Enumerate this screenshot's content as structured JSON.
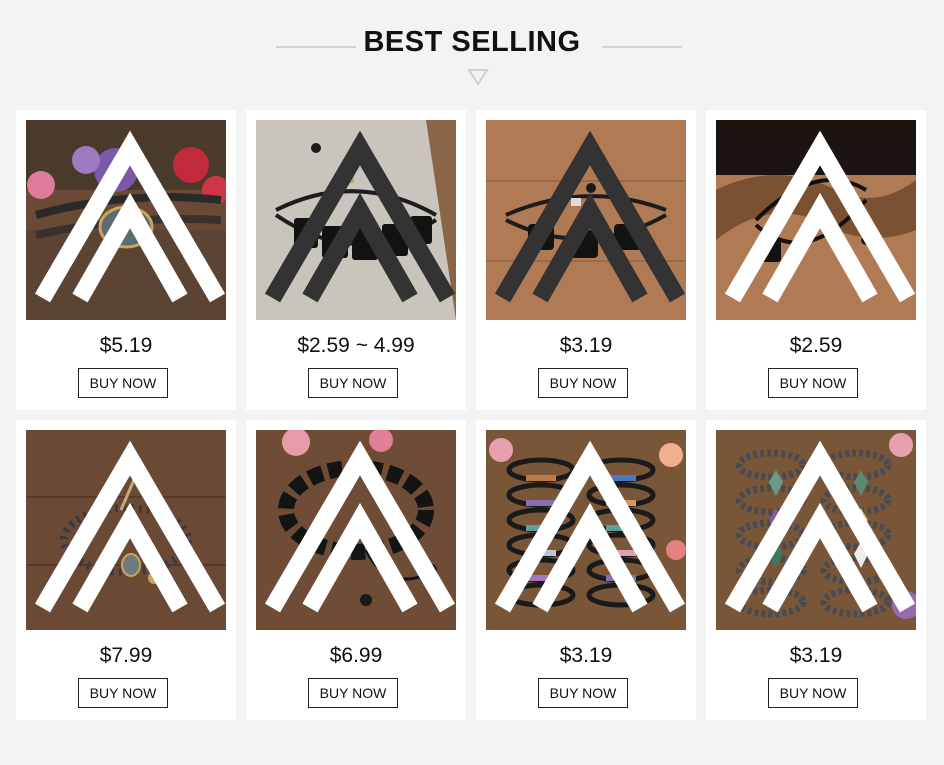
{
  "section": {
    "title": "BEST SELLING"
  },
  "products": [
    {
      "price": "$5.19",
      "buy_label": "BUY NOW",
      "image": "labradorite-wrap-bracelet"
    },
    {
      "price": "$2.59 ~ 4.99",
      "buy_label": "BUY NOW",
      "image": "black-tourmaline-bracelet"
    },
    {
      "price": "$3.19",
      "buy_label": "BUY NOW",
      "image": "black-tourmaline-bracelet"
    },
    {
      "price": "$2.59",
      "buy_label": "BUY NOW",
      "image": "black-stone-bracelet"
    },
    {
      "price": "$7.99",
      "buy_label": "BUY NOW",
      "image": "labradorite-bead-bracelet"
    },
    {
      "price": "$6.99",
      "buy_label": "BUY NOW",
      "image": "black-tourmaline-bead-bracelet"
    },
    {
      "price": "$3.19",
      "buy_label": "BUY NOW",
      "image": "chip-stone-bracelets"
    },
    {
      "price": "$3.19",
      "buy_label": "BUY NOW",
      "image": "hematite-crystal-point-bracelets"
    }
  ],
  "colors": {
    "background": "#f3f3f3",
    "card": "#ffffff",
    "text": "#111111"
  }
}
